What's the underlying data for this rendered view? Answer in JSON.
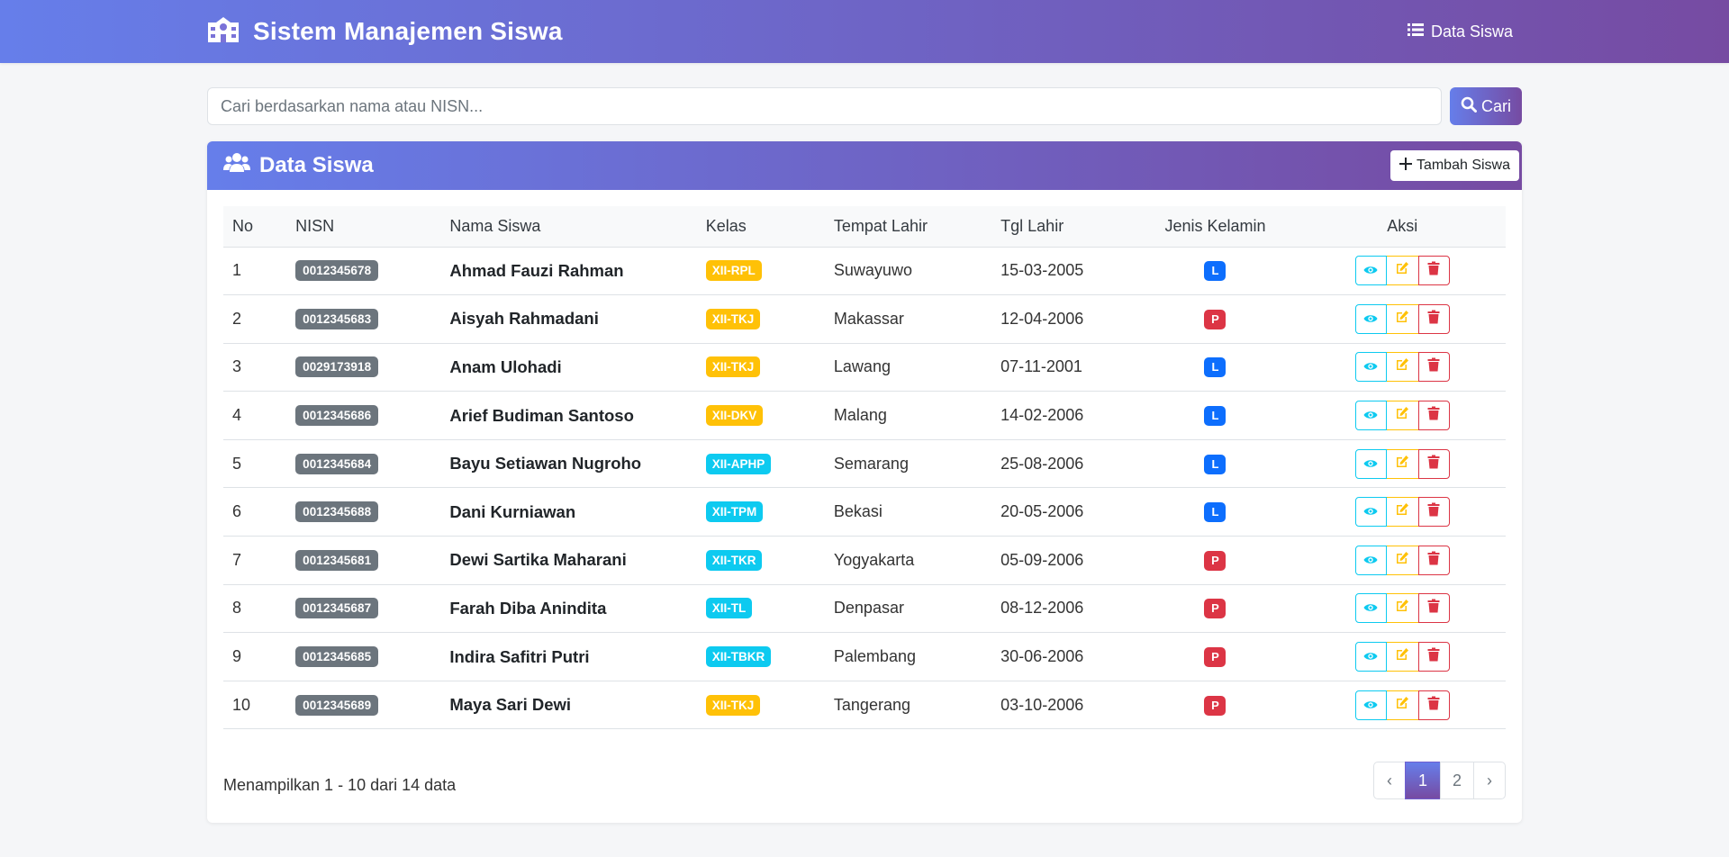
{
  "navbar": {
    "brand": "Sistem Manajemen Siswa",
    "brand_icon": "school-icon",
    "nav_link": "Data Siswa",
    "nav_icon": "list-icon"
  },
  "search": {
    "placeholder": "Cari berdasarkan nama atau NISN...",
    "value": "",
    "button_label": "Cari"
  },
  "card": {
    "title": "Data Siswa",
    "title_icon": "users-icon",
    "add_button_label": "Tambah Siswa"
  },
  "table": {
    "headers": [
      "No",
      "NISN",
      "Nama Siswa",
      "Kelas",
      "Tempat Lahir",
      "Tgl Lahir",
      "Jenis Kelamin",
      "Aksi"
    ],
    "rows": [
      {
        "no": "1",
        "nisn": "0012345678",
        "name": "Ahmad Fauzi Rahman",
        "kelas": "XII-RPL",
        "kelas_color": "#ffc107",
        "tempat": "Suwayuwo",
        "tgl": "15-03-2005",
        "jk": "L"
      },
      {
        "no": "2",
        "nisn": "0012345683",
        "name": "Aisyah Rahmadani",
        "kelas": "XII-TKJ",
        "kelas_color": "#ffc107",
        "tempat": "Makassar",
        "tgl": "12-04-2006",
        "jk": "P"
      },
      {
        "no": "3",
        "nisn": "0029173918",
        "name": "Anam Ulohadi",
        "kelas": "XII-TKJ",
        "kelas_color": "#ffc107",
        "tempat": "Lawang",
        "tgl": "07-11-2001",
        "jk": "L"
      },
      {
        "no": "4",
        "nisn": "0012345686",
        "name": "Arief Budiman Santoso",
        "kelas": "XII-DKV",
        "kelas_color": "#ffc107",
        "tempat": "Malang",
        "tgl": "14-02-2006",
        "jk": "L"
      },
      {
        "no": "5",
        "nisn": "0012345684",
        "name": "Bayu Setiawan Nugroho",
        "kelas": "XII-APHP",
        "kelas_color": "#0dcaf0",
        "tempat": "Semarang",
        "tgl": "25-08-2006",
        "jk": "L"
      },
      {
        "no": "6",
        "nisn": "0012345688",
        "name": "Dani Kurniawan",
        "kelas": "XII-TPM",
        "kelas_color": "#0dcaf0",
        "tempat": "Bekasi",
        "tgl": "20-05-2006",
        "jk": "L"
      },
      {
        "no": "7",
        "nisn": "0012345681",
        "name": "Dewi Sartika Maharani",
        "kelas": "XII-TKR",
        "kelas_color": "#0dcaf0",
        "tempat": "Yogyakarta",
        "tgl": "05-09-2006",
        "jk": "P"
      },
      {
        "no": "8",
        "nisn": "0012345687",
        "name": "Farah Diba Anindita",
        "kelas": "XII-TL",
        "kelas_color": "#0dcaf0",
        "tempat": "Denpasar",
        "tgl": "08-12-2006",
        "jk": "P"
      },
      {
        "no": "9",
        "nisn": "0012345685",
        "name": "Indira Safitri Putri",
        "kelas": "XII-TBKR",
        "kelas_color": "#0dcaf0",
        "tempat": "Palembang",
        "tgl": "30-06-2006",
        "jk": "P"
      },
      {
        "no": "10",
        "nisn": "0012345689",
        "name": "Maya Sari Dewi",
        "kelas": "XII-TKJ",
        "kelas_color": "#ffc107",
        "tempat": "Tangerang",
        "tgl": "03-10-2006",
        "jk": "P"
      }
    ]
  },
  "footer": {
    "info": "Menampilkan 1 - 10 dari 14 data",
    "pagination": {
      "prev": "‹",
      "pages": [
        "1",
        "2"
      ],
      "active_page": "1",
      "next": "›"
    }
  },
  "colors": {
    "gradient_start": "#667eea",
    "gradient_end": "#764ba2",
    "male": "#0d6efd",
    "female": "#dc3545",
    "nisn_badge": "#6c757d",
    "view": "#0dcaf0",
    "edit": "#ffc107",
    "delete": "#dc3545"
  }
}
